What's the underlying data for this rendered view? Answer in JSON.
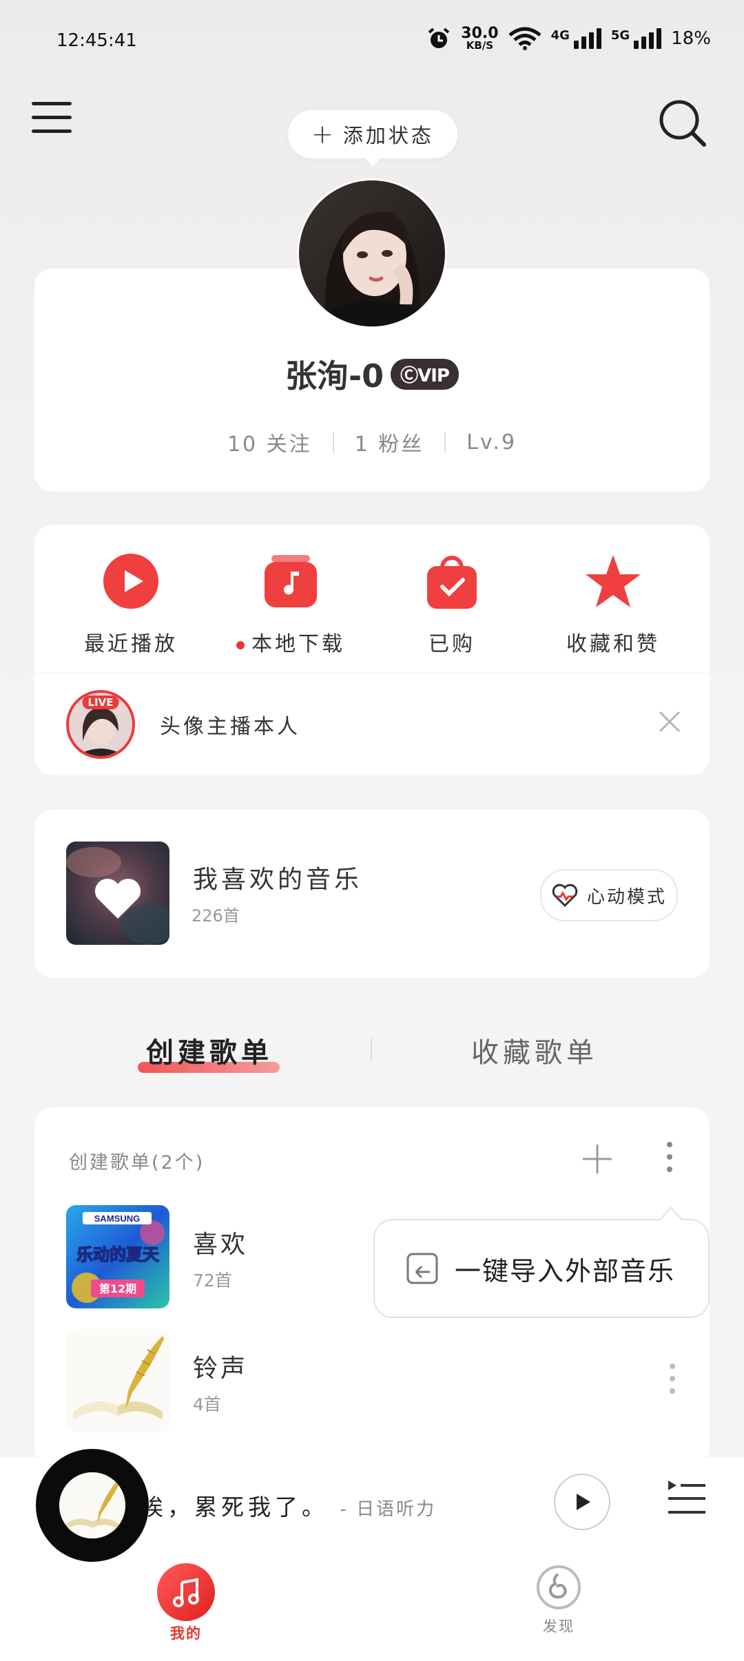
{
  "status_bar": {
    "time": "12:45:41",
    "net_speed": "30.0",
    "net_unit": "KB/S",
    "wifi_sub": "6",
    "sig1": "4G",
    "sig2": "5G",
    "battery": "18%"
  },
  "header": {
    "add_status_label": "添加状态"
  },
  "profile": {
    "username": "张洵-0",
    "vip_label": "ⒸVIP",
    "following": "10 关注",
    "followers": "1 粉丝",
    "level": "Lv.9"
  },
  "quick_actions": [
    {
      "label": "最近播放",
      "icon": "play-icon"
    },
    {
      "label": "本地下载",
      "icon": "music-download-icon"
    },
    {
      "label": "已购",
      "icon": "purchased-bag-icon"
    },
    {
      "label": "收藏和赞",
      "icon": "star-icon"
    }
  ],
  "live": {
    "tag": "LIVE",
    "text": "头像主播本人"
  },
  "liked": {
    "title": "我喜欢的音乐",
    "count": "226首",
    "mode_label": "心动模式"
  },
  "tabs": {
    "created": "创建歌单",
    "favorited": "收藏歌单"
  },
  "playlists": {
    "header": "创建歌单(2个)",
    "items": [
      {
        "name": "喜欢",
        "count": "72首",
        "cover_text": "乐动的夏天",
        "cover_brand": "SAMSUNG",
        "cover_issue": "第12期"
      },
      {
        "name": "铃声",
        "count": "4首"
      }
    ]
  },
  "popup": {
    "import_label": "一键导入外部音乐"
  },
  "player": {
    "title": "唉，累死我了。",
    "artist": "- 日语听力"
  },
  "nav": {
    "mine": "我的",
    "discover": "发现"
  },
  "colors": {
    "accent": "#e8342f",
    "background": "#f4f4f4"
  }
}
